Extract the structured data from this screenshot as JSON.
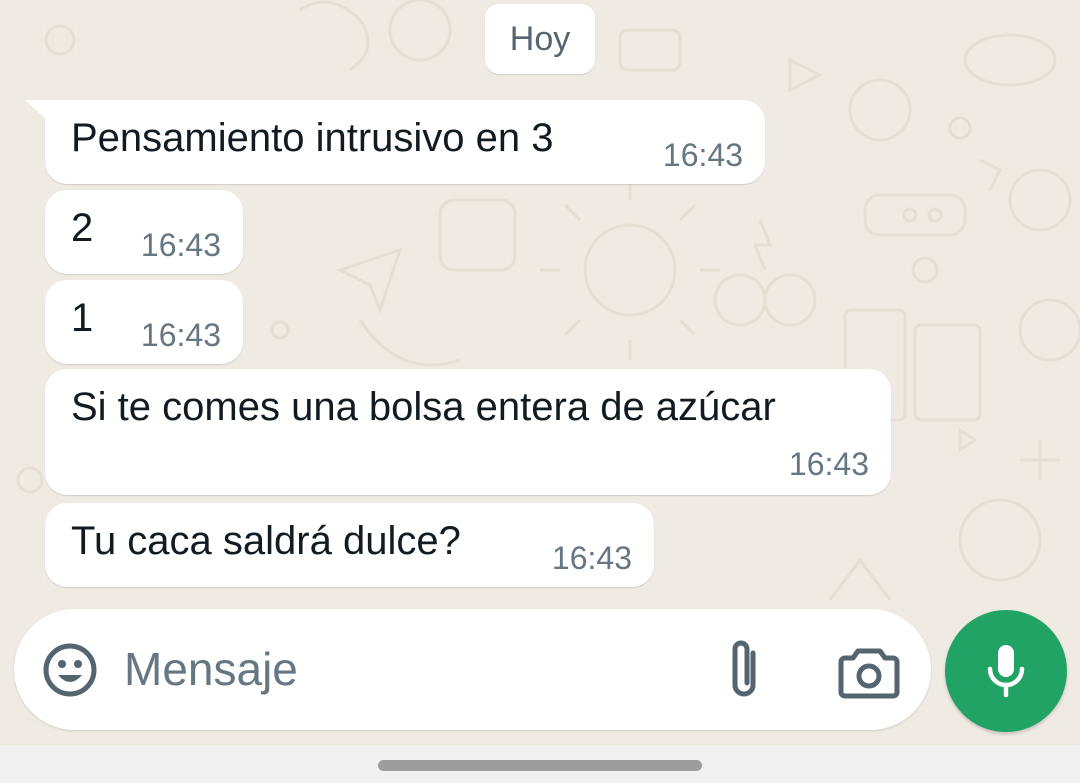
{
  "chat": {
    "date_label": "Hoy",
    "messages": [
      {
        "text": "Pensamiento intrusivo en 3",
        "time": "16:43"
      },
      {
        "text": "2",
        "time": "16:43"
      },
      {
        "text": "1",
        "time": "16:43"
      },
      {
        "text": "Si te comes una bolsa entera de azúcar",
        "time": "16:43"
      },
      {
        "text": "Tu caca saldrá dulce?",
        "time": "16:43"
      }
    ]
  },
  "composer": {
    "placeholder": "Mensaje",
    "icons": {
      "emoji": "emoji-icon",
      "attach": "paperclip-icon",
      "camera": "camera-icon",
      "mic": "microphone-icon"
    }
  },
  "colors": {
    "chat_background": "#efeae2",
    "bubble_background": "#ffffff",
    "accent_green": "#21a366",
    "timestamp_gray": "#667781"
  }
}
